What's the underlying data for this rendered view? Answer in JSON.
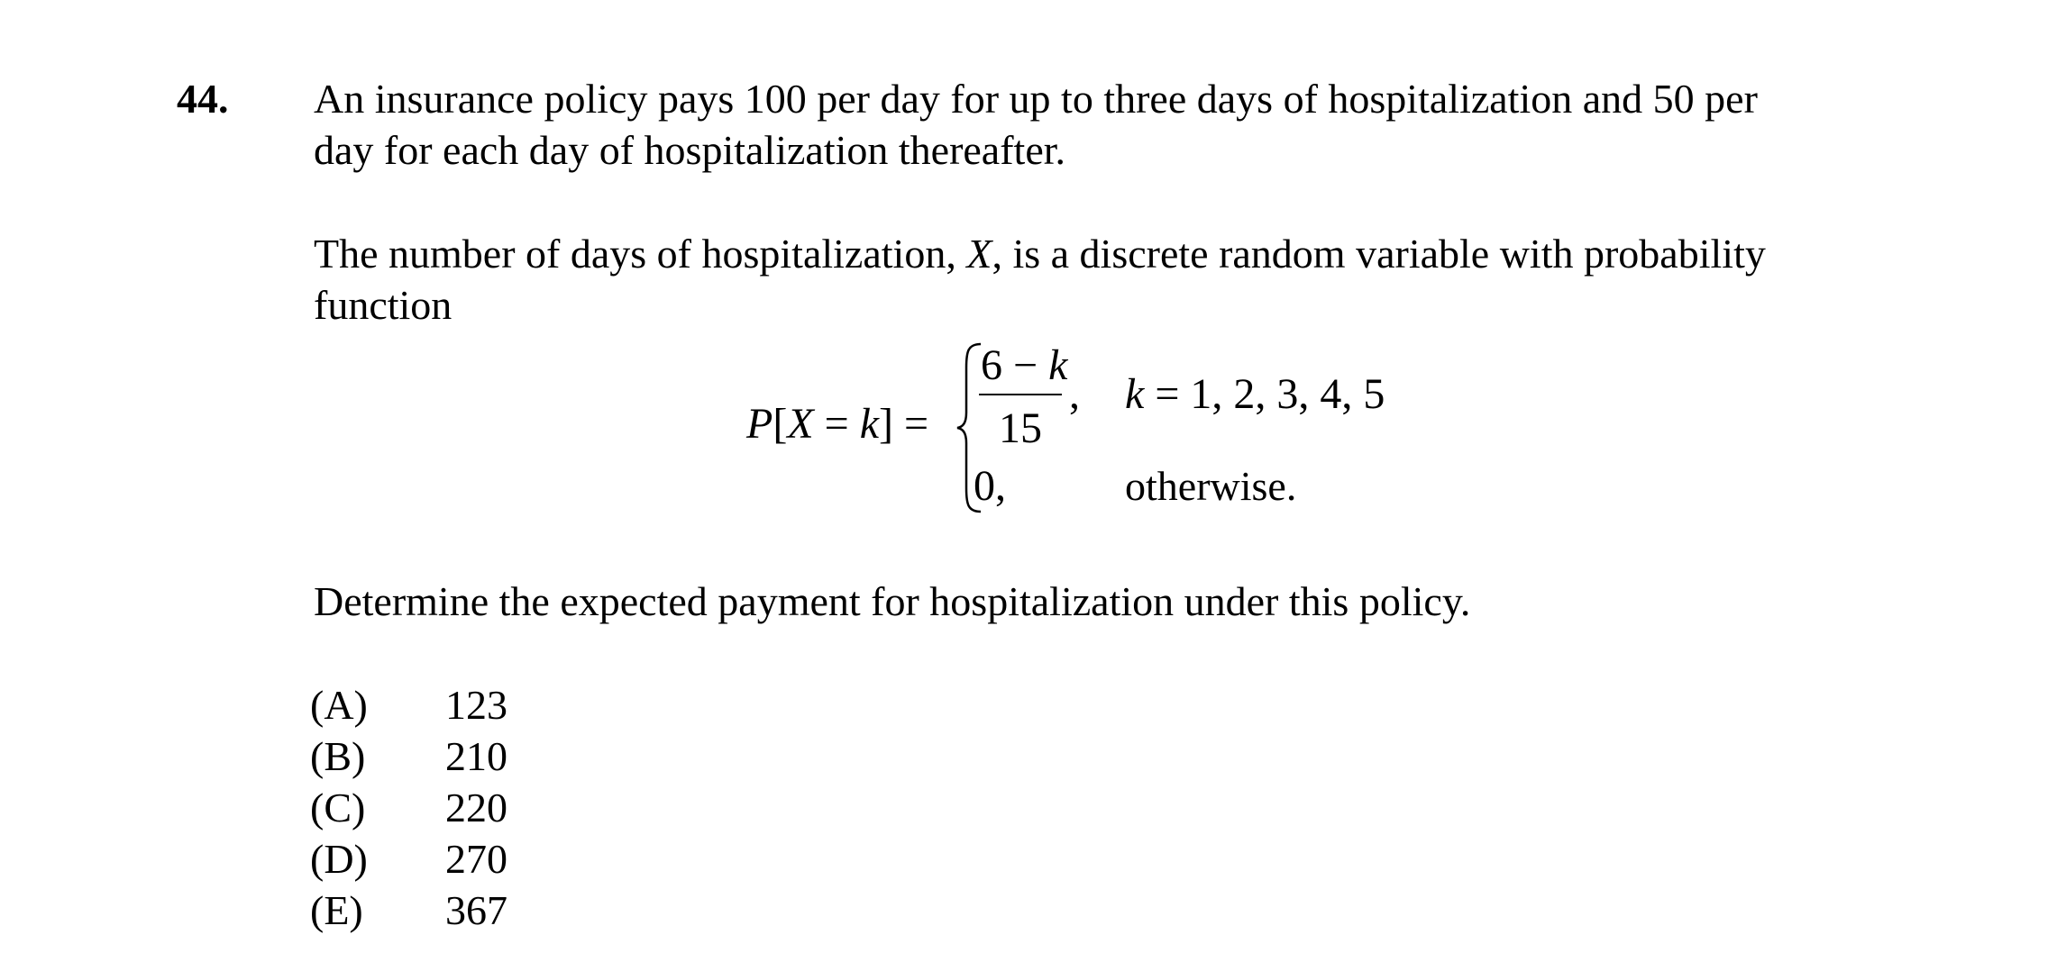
{
  "problem": {
    "number": "44.",
    "stem_line1": "An insurance policy pays 100 per day for up to three days of hospitalization and 50 per",
    "stem_line2": "day for each day of hospitalization thereafter.",
    "intro_prefix": "The number of days of hospitalization, ",
    "intro_var": "X",
    "intro_suffix": ", is a discrete random variable with probability",
    "intro_line2": "function",
    "formula": {
      "lhs_p": "P",
      "lhs_bracket_open": "[",
      "lhs_x": "X",
      "lhs_eq": " = ",
      "lhs_k": "k",
      "lhs_bracket_close": "]",
      "lhs_eq2": " =",
      "numerator_prefix": "6 − ",
      "numerator_k": "k",
      "denominator": "15",
      "case1_comma": ",",
      "case1_k": "k",
      "case1_condition": " = 1, 2, 3, 4, 5",
      "case2_value": "0,",
      "case2_condition": "otherwise."
    },
    "question": "Determine the expected payment for hospitalization under this policy.",
    "choices": [
      {
        "letter": "(A)",
        "value": "123"
      },
      {
        "letter": "(B)",
        "value": "210"
      },
      {
        "letter": "(C)",
        "value": "220"
      },
      {
        "letter": "(D)",
        "value": "270"
      },
      {
        "letter": "(E)",
        "value": "367"
      }
    ]
  }
}
